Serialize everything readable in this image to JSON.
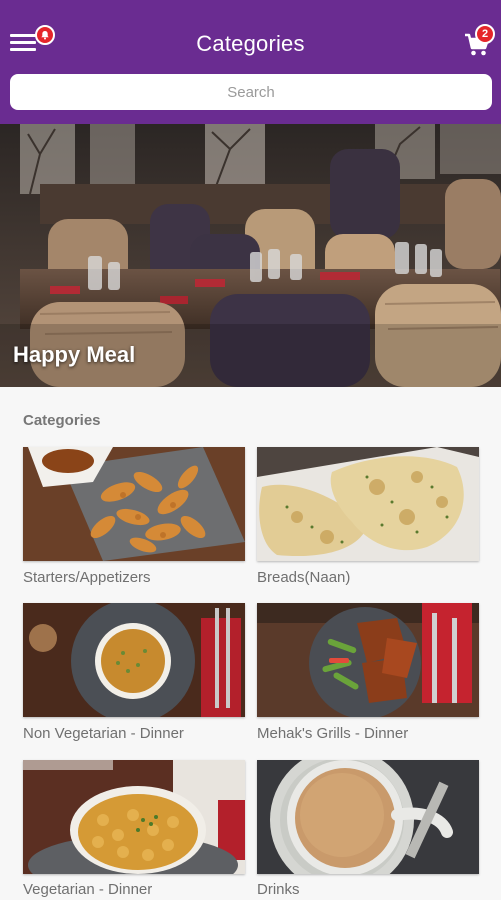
{
  "header": {
    "title": "Categories",
    "notification_count": "",
    "cart_count": "2",
    "colors": {
      "bar": "#6a2c91",
      "badge": "#e5262a"
    }
  },
  "search": {
    "placeholder": "Search"
  },
  "hero": {
    "label": "Happy Meal"
  },
  "categories_section": {
    "title": "Categories",
    "items": [
      {
        "label": "Starters/Appetizers",
        "icon": "fried-starters-photo"
      },
      {
        "label": "Breads(Naan)",
        "icon": "naan-bread-photo"
      },
      {
        "label": "Non Vegetarian - Dinner",
        "icon": "curry-bowl-photo"
      },
      {
        "label": "Mehak's Grills - Dinner",
        "icon": "grilled-chicken-photo"
      },
      {
        "label": "Vegetarian - Dinner",
        "icon": "chickpea-curry-photo"
      },
      {
        "label": "Drinks",
        "icon": "tea-cup-photo"
      }
    ]
  }
}
